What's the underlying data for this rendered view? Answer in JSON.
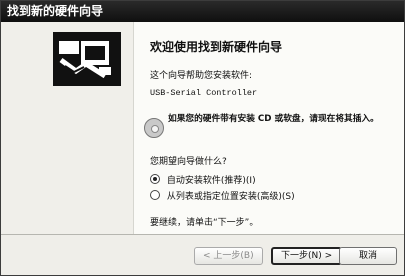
{
  "window": {
    "title": "找到新的硬件向导"
  },
  "wizard": {
    "heading": "欢迎使用找到新硬件向导",
    "description": "这个向导帮助您安装软件:",
    "device_name": "USB-Serial Controller",
    "cd_hint": "如果您的硬件带有安装 CD 或软盘，请现在将其插入。",
    "question": "您期望向导做什么?",
    "options": [
      {
        "label": "自动安装软件(推荐)(I)",
        "selected": true
      },
      {
        "label": "从列表或指定位置安装(高级)(S)",
        "selected": false
      }
    ],
    "continue_hint": "要继续，请单击“下一步”。"
  },
  "buttons": {
    "back": "< 上一步(B)",
    "next": "下一步(N) >",
    "cancel": "取消"
  },
  "icons": {
    "wizard": "hardware-wizard-icon",
    "cd": "cd-disc-icon"
  }
}
